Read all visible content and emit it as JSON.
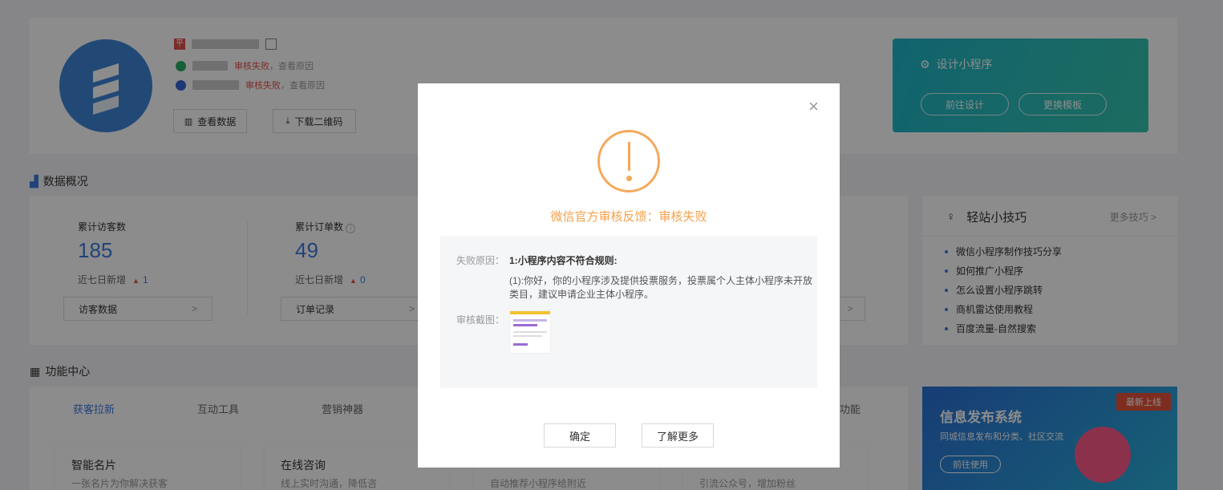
{
  "profile": {
    "badge_text": "平",
    "wechat_status": "审核失败",
    "wechat_suffix": "，查看原因",
    "baidu_status": "审核失败",
    "baidu_suffix": "，查看原因",
    "view_data_label": "查看数据",
    "download_qr_label": "下载二维码"
  },
  "design_banner": {
    "title": "设计小程序",
    "go_design_label": "前往设计",
    "change_template_label": "更换模板"
  },
  "overview": {
    "title": "数据概况",
    "stats": [
      {
        "label": "累计访客数",
        "value": "185",
        "sub_label": "近七日新增",
        "sub_value": "1",
        "link_label": "访客数据"
      },
      {
        "label": "累计订单数",
        "value": "49",
        "sub_label": "近七日新增",
        "sub_value": "0",
        "link_label": "订单记录"
      }
    ]
  },
  "tips": {
    "title": "轻站小技巧",
    "more_label": "更多技巧 >",
    "items": [
      "微信小程序制作技巧分享",
      "如何推广小程序",
      "怎么设置小程序跳转",
      "商机雷达使用教程",
      "百度流量-自然搜索"
    ]
  },
  "features": {
    "title": "功能中心",
    "tabs": [
      "获客拉新",
      "互动工具",
      "营销神器",
      "功能"
    ],
    "cards": [
      {
        "title": "智能名片",
        "desc": "一张名片为你解决获客"
      },
      {
        "title": "在线咨询",
        "desc": "线上实时沟通，降低咨"
      },
      {
        "title": "",
        "desc": "自动推荐小程序给附近"
      },
      {
        "title": "",
        "desc": "引流公众号，增加粉丝"
      }
    ]
  },
  "promo": {
    "title": "信息发布系统",
    "subtitle": "同城信息发布和分类、社区交流",
    "button_label": "前往使用",
    "ribbon": "最新上线"
  },
  "modal": {
    "title": "微信官方审核反馈：审核失败",
    "reason_label": "失败原因：",
    "reason_heading": "1:小程序内容不符合规则:",
    "reason_detail_line1": "(1):你好，你的小程序涉及提供投票服务，投票属个人主体小程序未开放",
    "reason_detail_line2": "类目，建议申请企业主体小程序。",
    "screenshot_label": "审核截图：",
    "confirm_label": "确定",
    "learn_more_label": "了解更多",
    "close_symbol": "×"
  },
  "colors": {
    "accent_blue": "#3d7be0",
    "warning_orange": "#f5a04a",
    "fail_red": "#e1504b",
    "banner_teal": "#1fb5c9"
  }
}
